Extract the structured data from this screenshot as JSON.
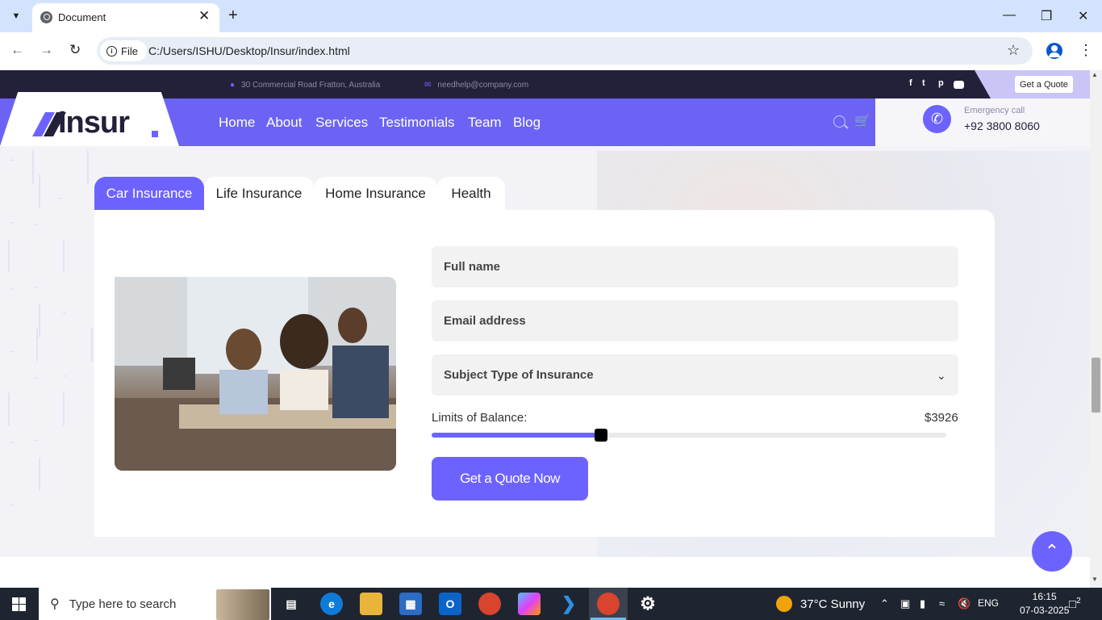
{
  "browser": {
    "tab_title": "Document",
    "url_chip": "File",
    "url": "C:/Users/ISHU/Desktop/Insur/index.html"
  },
  "site": {
    "topbar": {
      "address": "30 Commercial Road Fratton, Australia",
      "email": "needhelp@company.com",
      "quote_button": "Get a Quote",
      "social_icons": [
        "facebook-icon",
        "twitter-icon",
        "pinterest-icon",
        "youtube-icon"
      ]
    },
    "logo_text": "Insur",
    "nav": [
      "Home",
      "About",
      "Services",
      "Testimonials",
      "Team",
      "Blog"
    ],
    "emergency": {
      "label": "Emergency call",
      "phone": "+92 3800 8060"
    },
    "tabs": [
      "Car Insurance",
      "Life Insurance",
      "Home Insurance",
      "Health"
    ],
    "active_tab": "Car Insurance",
    "form": {
      "fullname_placeholder": "Full name",
      "email_placeholder": "Email address",
      "select_value": "Subject Type of Insurance",
      "limits_label": "Limits of Balance:",
      "limits_value": "$3926",
      "slider_fraction": 0.329,
      "submit": "Get a Quote Now"
    }
  },
  "taskbar": {
    "search_placeholder": "Type here to search",
    "weather": "37°C  Sunny",
    "lang": "ENG",
    "time": "16:15",
    "date": "07-03-2025",
    "notifications": "2"
  },
  "colors": {
    "accent": "#6c63ff",
    "dark": "#23203a",
    "taskbar": "#1f2530"
  }
}
